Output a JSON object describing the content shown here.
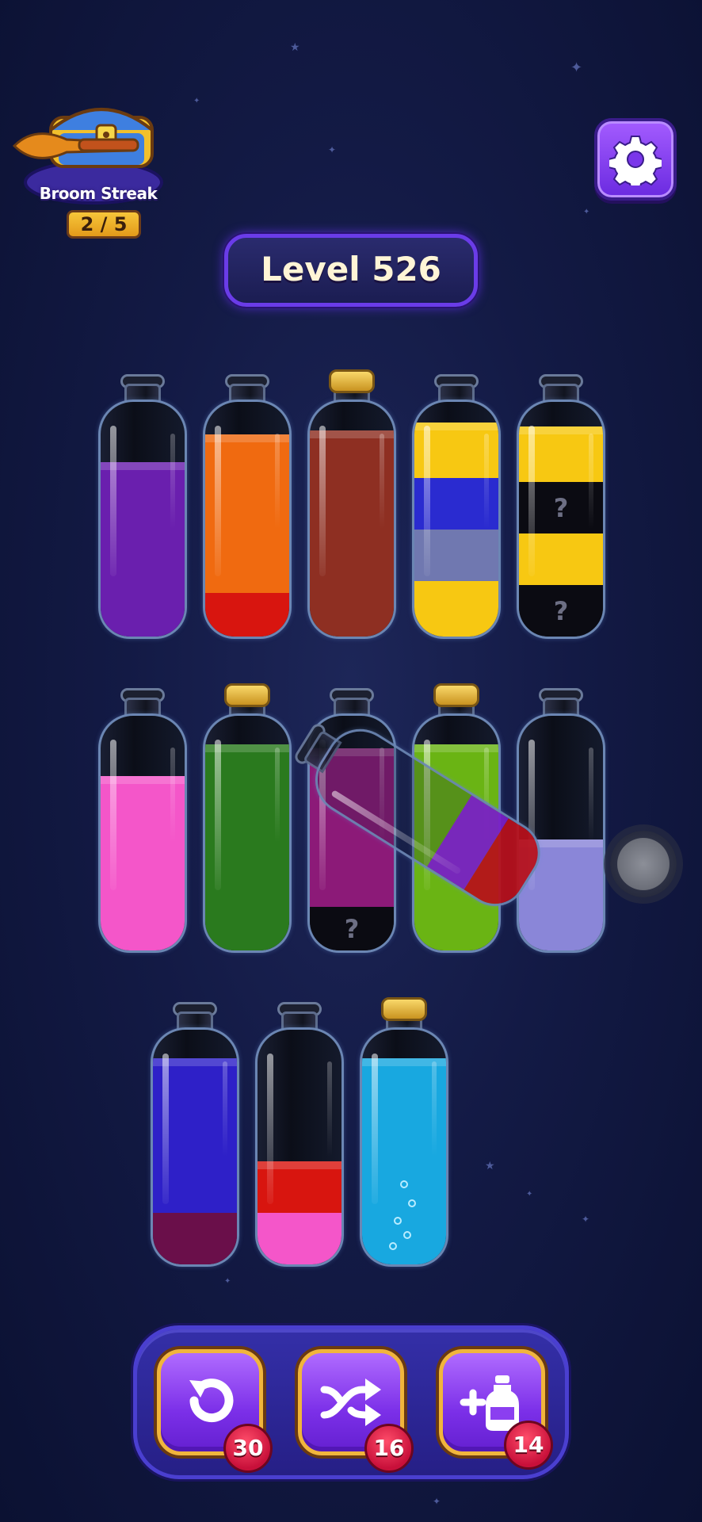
{
  "streak": {
    "label": "Broom Streak",
    "count": "2 / 5"
  },
  "settings": {
    "icon": "gear-icon"
  },
  "level": {
    "label": "Level 526"
  },
  "hidden_marker": "?",
  "bottles": [
    {
      "row": 1,
      "col": 1,
      "corked": false,
      "layers": [
        {
          "color": "#6a1fae",
          "units": 2.2
        }
      ]
    },
    {
      "row": 1,
      "col": 2,
      "corked": false,
      "layers": [
        {
          "color": "#d8150f",
          "units": 0.55
        },
        {
          "color": "#f06a10",
          "units": 2.0
        }
      ]
    },
    {
      "row": 1,
      "col": 3,
      "corked": true,
      "layers": [
        {
          "color": "#8e2f22",
          "units": 2.6
        }
      ]
    },
    {
      "row": 1,
      "col": 4,
      "corked": false,
      "layers": [
        {
          "color": "#f7c812",
          "units": 0.7
        },
        {
          "color": "#7078b0",
          "units": 0.65
        },
        {
          "color": "#2a2bd0",
          "units": 0.65
        },
        {
          "color": "#f7c812",
          "units": 0.7
        }
      ]
    },
    {
      "row": 1,
      "col": 5,
      "corked": false,
      "layers": [
        {
          "color": "#0b0b12",
          "units": 0.65,
          "hidden": true
        },
        {
          "color": "#f7c812",
          "units": 0.65
        },
        {
          "color": "#0b0b12",
          "units": 0.65,
          "hidden": true
        },
        {
          "color": "#f7c812",
          "units": 0.7
        }
      ]
    },
    {
      "row": 2,
      "col": 1,
      "corked": false,
      "layers": [
        {
          "color": "#f456c9",
          "units": 2.2
        }
      ]
    },
    {
      "row": 2,
      "col": 2,
      "corked": true,
      "layers": [
        {
          "color": "#2a7a1e",
          "units": 2.6
        }
      ]
    },
    {
      "row": 2,
      "col": 3,
      "corked": false,
      "layers": [
        {
          "color": "#0b0b12",
          "units": 0.55,
          "hidden": true
        },
        {
          "color": "#8c1a78",
          "units": 2.0
        }
      ]
    },
    {
      "row": 2,
      "col": 4,
      "corked": true,
      "layers": [
        {
          "color": "#6ab414",
          "units": 2.6
        }
      ]
    },
    {
      "row": 2,
      "col": 5,
      "corked": false,
      "layers": [
        {
          "color": "#8a86d8",
          "units": 1.4
        }
      ]
    },
    {
      "row": 3,
      "col": 1,
      "corked": false,
      "layers": [
        {
          "color": "#6a0f4a",
          "units": 0.65
        },
        {
          "color": "#2e20c8",
          "units": 1.95
        }
      ]
    },
    {
      "row": 3,
      "col": 2,
      "corked": false,
      "layers": [
        {
          "color": "#f456c9",
          "units": 0.65
        },
        {
          "color": "#d8150f",
          "units": 0.65
        }
      ]
    },
    {
      "row": 3,
      "col": 3,
      "corked": true,
      "layers": [
        {
          "color": "#18a8e0",
          "units": 2.6
        }
      ],
      "bubbles": true
    }
  ],
  "pouring_bottle": {
    "layers": [
      {
        "color": "#b8101a",
        "units": 0.6
      },
      {
        "color": "#7a1ec8",
        "units": 0.55
      }
    ]
  },
  "tools": [
    {
      "name": "undo",
      "icon": "undo-icon",
      "count": "30"
    },
    {
      "name": "shuffle",
      "icon": "shuffle-icon",
      "count": "16"
    },
    {
      "name": "add-bottle",
      "icon": "add-bottle-icon",
      "count": "14"
    }
  ]
}
